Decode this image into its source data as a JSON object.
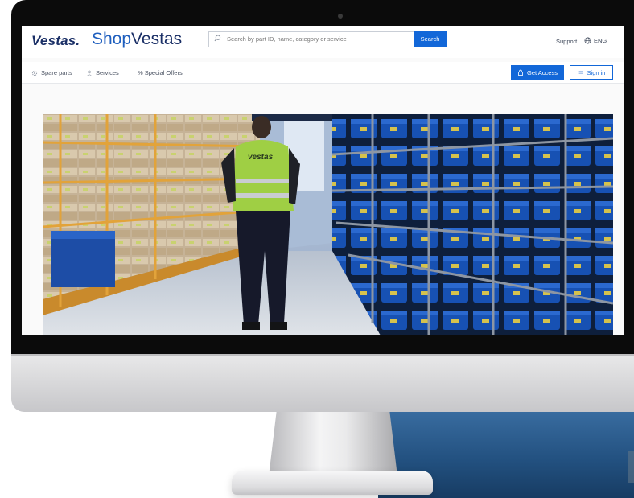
{
  "header": {
    "logo_text": "Vestas",
    "brand_prefix": "Shop",
    "brand_suffix": "Vestas",
    "search_placeholder": "Search by part ID, name, category or service",
    "search_button": "Search",
    "support_label": "Support",
    "language_label": "ENG"
  },
  "nav": {
    "items": [
      {
        "label": "Spare parts",
        "icon": "gear-icon"
      },
      {
        "label": "Services",
        "icon": "person-icon"
      },
      {
        "label": "% Special Offers",
        "icon": "percent-icon"
      }
    ],
    "get_access": "Get Access",
    "sign_in": "Sign in"
  },
  "hero": {
    "vest_text": "vestas"
  },
  "colors": {
    "accent": "#1267d8",
    "brand_navy": "#1a2f66",
    "bezel": "#0b0b0b"
  }
}
